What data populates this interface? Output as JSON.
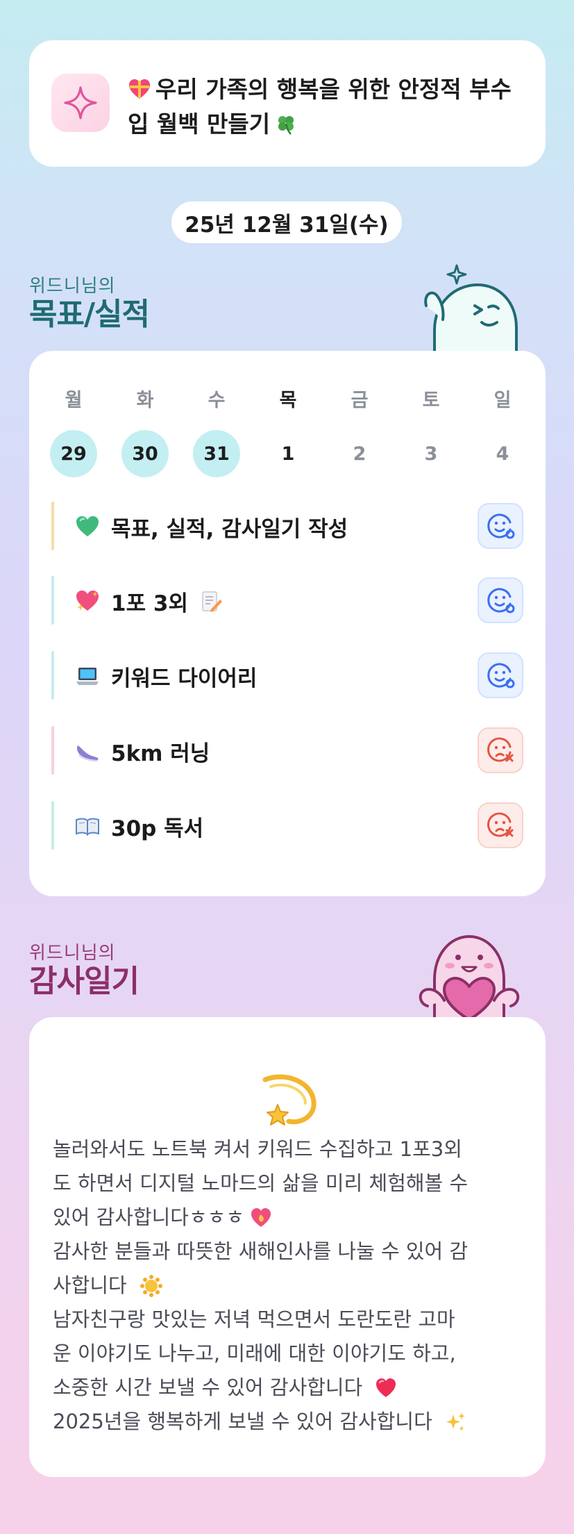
{
  "banner": {
    "icon": "sparkle-icon",
    "line1": "우리 가족의 행복을 위한 안정적 부수",
    "line2": "입 월백 만들기"
  },
  "date": "25년 12월 31일(수)",
  "goals_section": {
    "subtitle": "위드니님의",
    "title": "목표/실적"
  },
  "week": [
    {
      "day": "월",
      "date": "29",
      "state": "past"
    },
    {
      "day": "화",
      "date": "30",
      "state": "past"
    },
    {
      "day": "수",
      "date": "31",
      "state": "past"
    },
    {
      "day": "목",
      "date": "1",
      "state": "today"
    },
    {
      "day": "금",
      "date": "2",
      "state": "future"
    },
    {
      "day": "토",
      "date": "3",
      "state": "future"
    },
    {
      "day": "일",
      "date": "4",
      "state": "future"
    }
  ],
  "tasks": [
    {
      "label": "목표, 실적, 감사일기 작성",
      "icon": "green-heart-icon",
      "bar_color": "#f6dcae",
      "status": "done"
    },
    {
      "label": "1포 3외",
      "icon": "sparkling-heart-icon",
      "extra_icon": "memo-icon",
      "bar_color": "#c6eaf0",
      "status": "done"
    },
    {
      "label": "키워드 다이어리",
      "icon": "laptop-icon",
      "bar_color": "#c6eaf0",
      "status": "done"
    },
    {
      "label": "5km 러닝",
      "icon": "running-shoe-icon",
      "bar_color": "#f6d0e2",
      "status": "missed"
    },
    {
      "label": "30p 독서",
      "icon": "open-book-icon",
      "bar_color": "#c4efe0",
      "status": "missed"
    }
  ],
  "gratitude_section": {
    "subtitle": "위드니님의",
    "title": "감사일기"
  },
  "gratitude": {
    "icon": "dizzy-comet-icon",
    "lines": [
      "놀러와서도 노트북 켜서 키워드 수집하고 1포3외",
      "도 하면서 디지털 노마드의 삶을 미리 체험해볼 수",
      "있어 감사합니다ㅎㅎㅎ",
      "감사한 분들과 따뜻한 새해인사를 나눌 수 있어 감",
      "사합니다",
      "남자친구랑 맛있는 저녁 먹으면서 도란도란 고마",
      "운 이야기도 나누고, 미래에 대한 이야기도 하고,",
      "소중한 시간 보낼 수 있어 감사합니다",
      "2025년을 행복하게 보낼 수 있어 감사합니다"
    ]
  },
  "colors": {
    "accent_teal": "#1f6b73",
    "accent_plum": "#8c2f66",
    "done_blue": "#3a6ff0",
    "missed_red": "#e5533f"
  }
}
